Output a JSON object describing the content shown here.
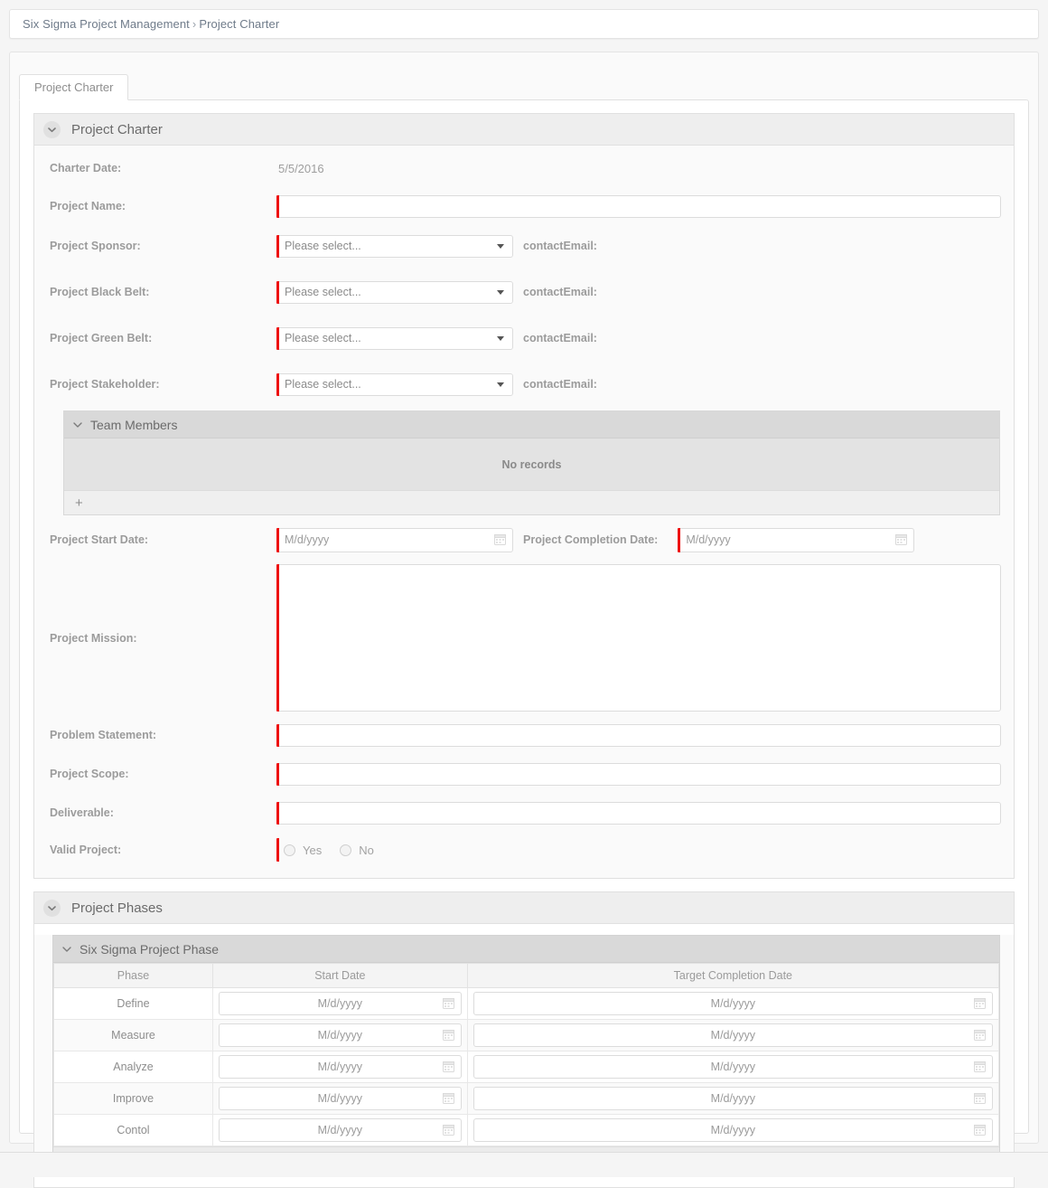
{
  "breadcrumb": {
    "root": "Six Sigma Project Management",
    "separator": "›",
    "current": "Project Charter"
  },
  "tab": {
    "label": "Project Charter"
  },
  "sections": {
    "charter": {
      "title": "Project Charter",
      "chevron_icon": "chevron-down-icon",
      "fields": {
        "charter_date_label": "Charter Date:",
        "charter_date_value": "5/5/2016",
        "project_name_label": "Project Name:",
        "project_name_value": "",
        "project_sponsor_label": "Project Sponsor:",
        "project_black_belt_label": "Project Black Belt:",
        "project_green_belt_label": "Project Green Belt:",
        "project_stakeholder_label": "Project Stakeholder:",
        "select_placeholder": "Please select...",
        "contact_email_label": "contactEmail:",
        "project_start_date_label": "Project Start Date:",
        "project_completion_date_label": "Project Completion Date:",
        "date_placeholder": "M/d/yyyy",
        "project_mission_label": "Project Mission:",
        "project_mission_value": "",
        "problem_statement_label": "Problem Statement:",
        "problem_statement_value": "",
        "project_scope_label": "Project Scope:",
        "project_scope_value": "",
        "deliverable_label": "Deliverable:",
        "deliverable_value": "",
        "valid_project_label": "Valid Project:",
        "valid_yes": "Yes",
        "valid_no": "No"
      },
      "team_members": {
        "title": "Team Members",
        "empty_text": "No records",
        "add_label": "+"
      }
    },
    "phases": {
      "title": "Project Phases",
      "grid": {
        "title": "Six Sigma Project Phase",
        "columns": [
          "Phase",
          "Start Date",
          "Target Completion Date"
        ],
        "date_placeholder": "M/d/yyyy",
        "rows": [
          {
            "phase": "Define",
            "start_date": "M/d/yyyy",
            "target_date": "M/d/yyyy"
          },
          {
            "phase": "Measure",
            "start_date": "M/d/yyyy",
            "target_date": "M/d/yyyy"
          },
          {
            "phase": "Analyze",
            "start_date": "M/d/yyyy",
            "target_date": "M/d/yyyy"
          },
          {
            "phase": "Improve",
            "start_date": "M/d/yyyy",
            "target_date": "M/d/yyyy"
          },
          {
            "phase": "Contol",
            "start_date": "M/d/yyyy",
            "target_date": "M/d/yyyy"
          }
        ]
      }
    }
  },
  "colors": {
    "required_marker": "#ee1111",
    "page_background": "#f5f5f5",
    "panel_background": "#fafafa",
    "header_background": "#eeeeee",
    "subheader_background": "#d9d9d9",
    "label_text": "#9b9b9b"
  }
}
